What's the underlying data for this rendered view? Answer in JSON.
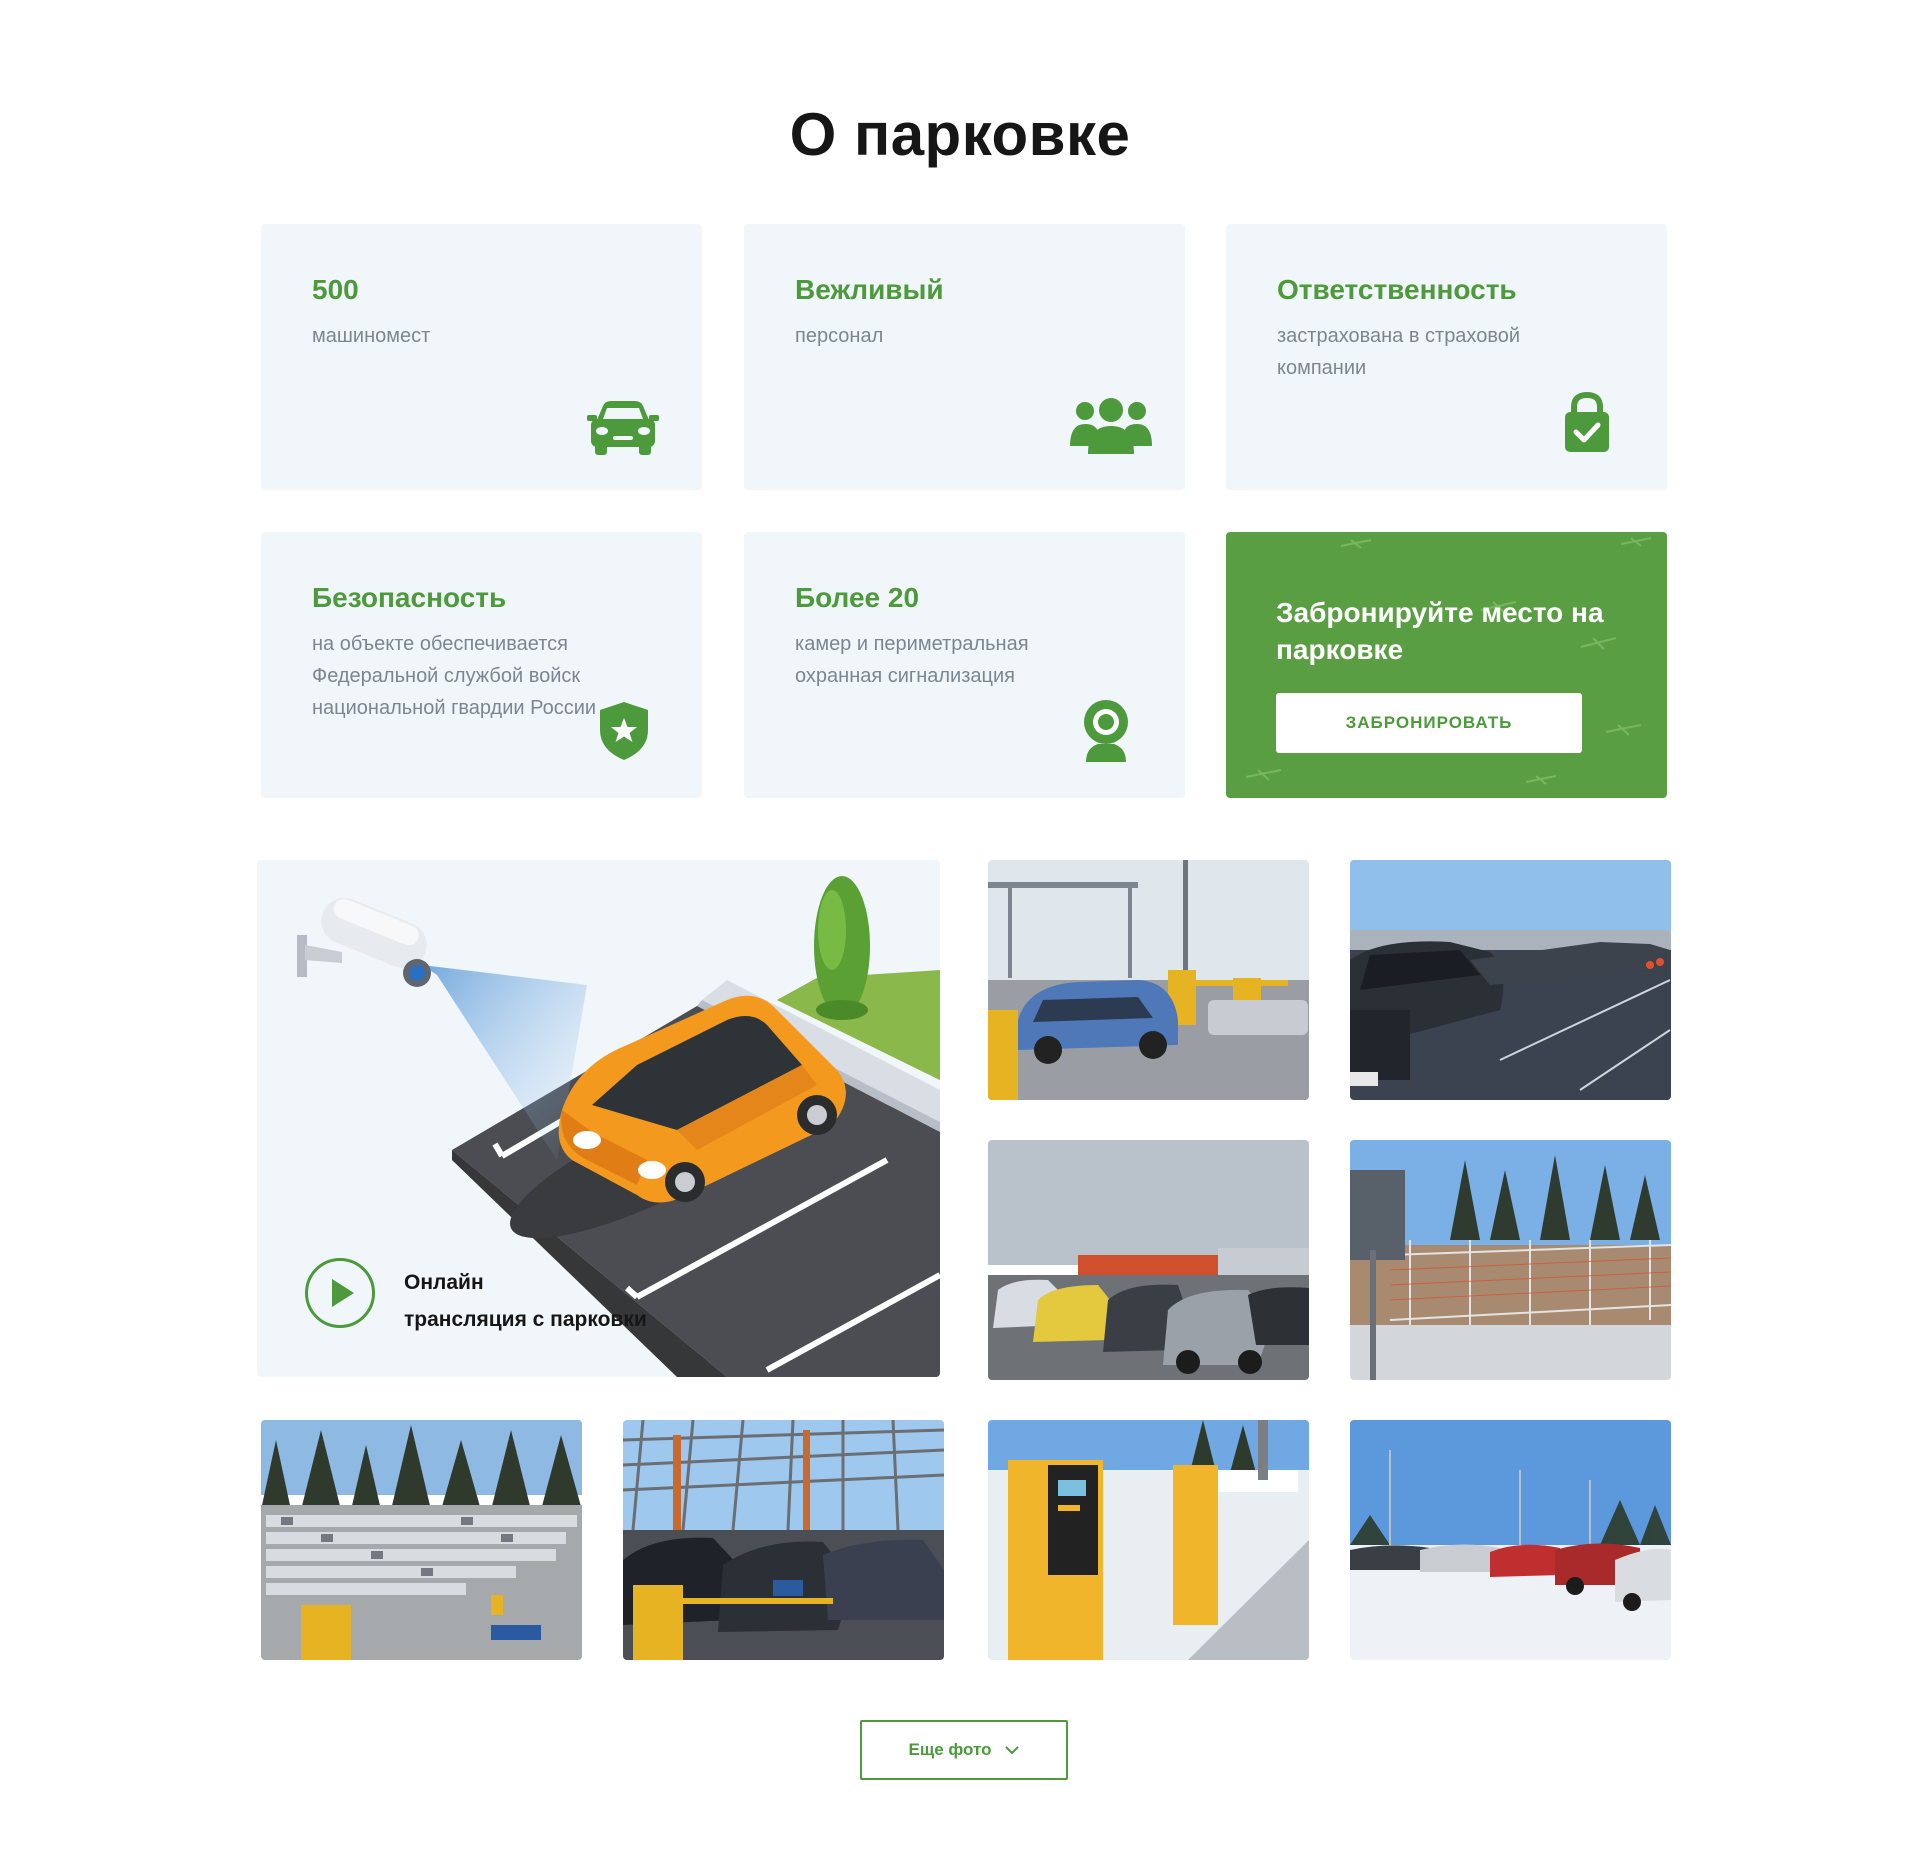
{
  "section": {
    "title": "О парковке"
  },
  "features": [
    {
      "num": "500",
      "desc": "машиномест",
      "icon": "car-icon"
    },
    {
      "num": "Вежливый",
      "desc": "персонал",
      "icon": "people-icon"
    },
    {
      "num": "Ответственность",
      "desc": "застрахована в страховой компании",
      "icon": "lock-check-icon"
    },
    {
      "num": "Безопасность",
      "desc": "на объекте обеспечивается Федеральной службой войск национальной гвардии России",
      "icon": "shield-star-icon"
    },
    {
      "num": "Более 20",
      "desc": "камер и периметральная охранная сигнализация",
      "icon": "webcam-icon"
    }
  ],
  "cta": {
    "text": "Забронируйте место на парковке",
    "button": "ЗАБРОНИРОВАТЬ"
  },
  "video": {
    "line1": "Онлайн",
    "line2": "трансляция с парковки",
    "icon": "play-icon"
  },
  "gallery": {
    "photos": [
      {
        "name": "photo-entry-barriers"
      },
      {
        "name": "photo-suv-row"
      },
      {
        "name": "photo-terminal-lot"
      },
      {
        "name": "photo-fence-lot"
      },
      {
        "name": "photo-aerial-lot"
      },
      {
        "name": "photo-covered-parking"
      },
      {
        "name": "photo-ticket-machines"
      },
      {
        "name": "photo-snow-lot"
      }
    ],
    "more_label": "Еще фото",
    "more_icon": "chevron-down-icon"
  },
  "colors": {
    "accent": "#4c9a3c",
    "card_bg": "#f1f6fa",
    "cta_bg": "#5a9e43",
    "text_muted": "#7d8591"
  }
}
